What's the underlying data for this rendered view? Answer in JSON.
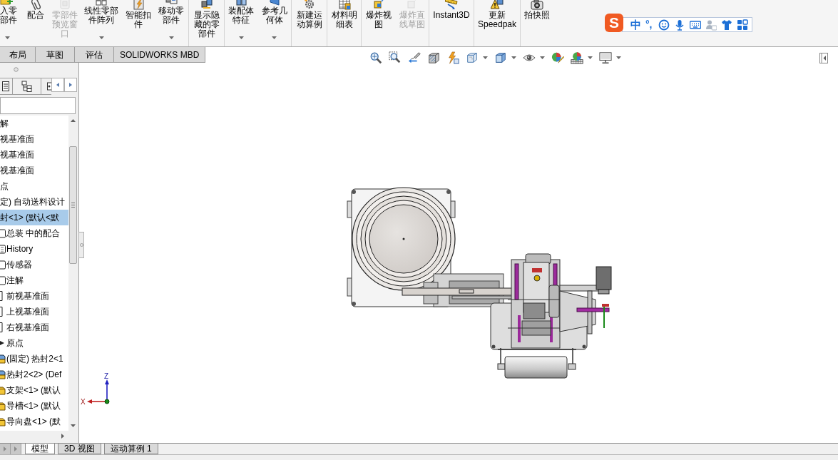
{
  "toolbar": {
    "groups": [
      {
        "items": [
          {
            "label": "入零部件",
            "kind": "insert",
            "dropdown": true,
            "disabled": false
          },
          {
            "label": "配合",
            "kind": "mate",
            "dropdown": false,
            "disabled": false
          },
          {
            "label": "零部件预览窗口",
            "kind": "preview",
            "dropdown": false,
            "disabled": true
          },
          {
            "label": "线性零部件阵列",
            "kind": "pattern",
            "dropdown": true,
            "disabled": false
          },
          {
            "label": "智能扣件",
            "kind": "fastener",
            "dropdown": false,
            "disabled": false
          },
          {
            "label": "移动零部件",
            "kind": "move",
            "dropdown": true,
            "disabled": false
          }
        ]
      },
      {
        "items": [
          {
            "label": "显示隐藏的零部件",
            "kind": "showhide",
            "dropdown": false,
            "disabled": false
          }
        ]
      },
      {
        "items": [
          {
            "label": "装配体特征",
            "kind": "features",
            "dropdown": true,
            "disabled": false
          },
          {
            "label": "参考几何体",
            "kind": "geometry",
            "dropdown": true,
            "disabled": false
          }
        ]
      },
      {
        "items": [
          {
            "label": "新建运动算例",
            "kind": "motion",
            "dropdown": false,
            "disabled": false
          }
        ]
      },
      {
        "items": [
          {
            "label": "材料明细表",
            "kind": "bom",
            "dropdown": false,
            "disabled": false
          }
        ]
      },
      {
        "items": [
          {
            "label": "爆炸视图",
            "kind": "explode",
            "dropdown": false,
            "disabled": false
          },
          {
            "label": "爆炸直线草图",
            "kind": "explodeline",
            "dropdown": false,
            "disabled": true
          }
        ]
      },
      {
        "items": [
          {
            "label": "Instant3D",
            "kind": "instant3d",
            "dropdown": false,
            "disabled": false
          }
        ]
      },
      {
        "items": [
          {
            "label": "更新\nSpeedpak",
            "kind": "speedpak",
            "dropdown": false,
            "disabled": false
          }
        ]
      },
      {
        "items": [
          {
            "label": "拍快照",
            "kind": "snapshot",
            "dropdown": false,
            "disabled": false
          }
        ]
      }
    ]
  },
  "ime_bar": {
    "logo": "S",
    "mode": "中",
    "punctuation": "°,",
    "tools": [
      {
        "kind": "emoji",
        "disabled": false
      },
      {
        "kind": "voice",
        "disabled": false
      },
      {
        "kind": "keyboard",
        "disabled": false
      },
      {
        "kind": "account",
        "disabled": true
      },
      {
        "kind": "skin",
        "disabled": false
      },
      {
        "kind": "toolbox",
        "disabled": false
      }
    ]
  },
  "tabs": [
    {
      "label": "布局",
      "selected": false
    },
    {
      "label": "草图",
      "selected": false
    },
    {
      "label": "评估",
      "selected": false
    },
    {
      "label": "SOLIDWORKS MBD",
      "selected": false
    }
  ],
  "view_toolbar": [
    {
      "kind": "zoomfit",
      "dropdown": false
    },
    {
      "kind": "zoomarea",
      "dropdown": false
    },
    {
      "kind": "previous",
      "dropdown": false
    },
    {
      "kind": "section",
      "dropdown": false
    },
    {
      "kind": "annotation",
      "dropdown": false
    },
    {
      "kind": "orientation",
      "dropdown": true
    },
    {
      "kind": "display",
      "dropdown": true
    },
    {
      "kind": "hideshow",
      "dropdown": true
    },
    {
      "kind": "appearance",
      "dropdown": false
    },
    {
      "kind": "scene",
      "dropdown": true
    },
    {
      "kind": "settings",
      "dropdown": true
    }
  ],
  "feature_tree": {
    "items": [
      {
        "label": "解",
        "selected": false
      },
      {
        "label": "视基准面",
        "selected": false
      },
      {
        "label": "视基准面",
        "selected": false
      },
      {
        "label": "视基准面",
        "selected": false
      },
      {
        "label": "点",
        "selected": false
      },
      {
        "label": "定) 自动送料设计",
        "selected": false
      },
      {
        "label": "封<1> (默认<默",
        "selected": true,
        "children": [
          {
            "label": "总装 中的配合",
            "kind": "mates",
            "selected": false
          },
          {
            "label": "History",
            "kind": "history",
            "selected": false
          },
          {
            "label": "传感器",
            "kind": "sensors",
            "selected": false
          },
          {
            "label": "注解",
            "kind": "annotations",
            "selected": false
          },
          {
            "label": "前视基准面",
            "kind": "plane",
            "selected": false
          },
          {
            "label": "上视基准面",
            "kind": "plane",
            "selected": false
          },
          {
            "label": "右视基准面",
            "kind": "plane",
            "selected": false
          },
          {
            "label": "原点",
            "kind": "origin",
            "selected": false
          },
          {
            "label": "(固定) 热封2<1",
            "kind": "assembly",
            "selected": false
          },
          {
            "label": "热封2<2> (Def",
            "kind": "assembly",
            "selected": false
          },
          {
            "label": "支架<1> (默认",
            "kind": "part",
            "selected": false
          },
          {
            "label": "导槽<1> (默认",
            "kind": "part",
            "selected": false
          },
          {
            "label": "导向盘<1> (默",
            "kind": "part",
            "selected": false
          }
        ]
      }
    ]
  },
  "viewport": {
    "triad": {
      "z_label": "Z",
      "x_label": "X"
    }
  },
  "bottom_tabs": [
    {
      "label": "模型",
      "selected": true
    },
    {
      "label": "3D 视图",
      "selected": false
    },
    {
      "label": "运动算例 1",
      "selected": false
    }
  ]
}
